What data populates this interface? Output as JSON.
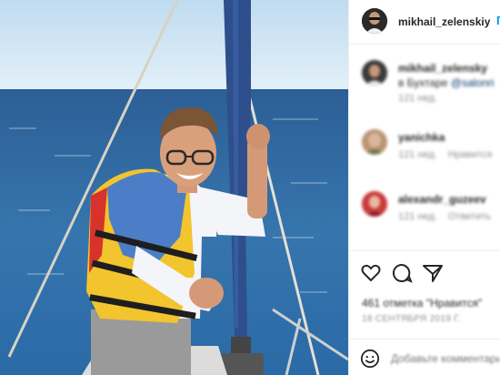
{
  "post": {
    "author": "mikhail_zelenskiy",
    "follow_label": "П"
  },
  "comments": [
    {
      "user": "mikhail_zelensky",
      "text": "в Бухтаре",
      "link": "@salonri",
      "meta": [
        "121 нед."
      ]
    },
    {
      "user": "yanichka",
      "text": "",
      "link": "",
      "meta": [
        "121 нед.",
        "Нравится"
      ]
    },
    {
      "user": "alexandr_guzeev",
      "text": "",
      "link": "",
      "meta": [
        "121 нед.",
        "Ответить"
      ]
    }
  ],
  "actions": {
    "icons": [
      "heart-icon",
      "comment-icon",
      "share-icon"
    ]
  },
  "likes_text": "461 отметка \"Нравится\"",
  "date_text": "18 СЕНТЯБРЯ 2019 Г.",
  "add_comment_placeholder": "Добавьте комментарий...",
  "colors": {
    "sea": "#2f6fa8",
    "sky": "#cfe6f5",
    "vest_yellow": "#f2c42e",
    "vest_blue": "#4b7ec7",
    "mast_rope": "#2e4f8c",
    "link_blue": "#0095f6"
  }
}
